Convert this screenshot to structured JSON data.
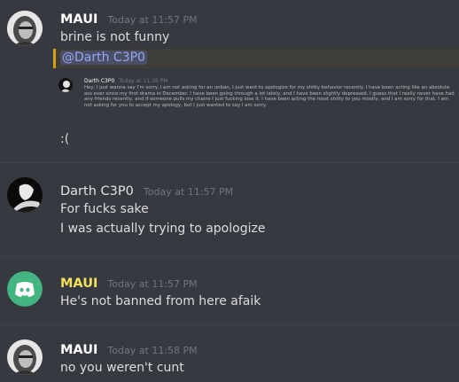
{
  "messages": [
    {
      "username": "MAUI",
      "timestamp": "Today at 11:57 PM",
      "lines": [
        "brine is not funny"
      ],
      "mention": "@Darth C3P0",
      "embed": {
        "username": "Darth C3P0",
        "timestamp": "Today at 11:38 PM",
        "text": "Hey, I just wanna say I'm sorry. I am not asking for an unban, I just want to apologize for my shitty behavior recently. I have been acting like an absolute ass ever since my first drama in December. I have been going through a lot lately, and I have been slightly depressed. I guess that I really never have had any friends recently, and if someone pulls my chains I just fucking lose it. I have been acting the most shitty to you mostly, and I am sorry for that. I am not asking for you to accept my apology, but I just wanted to say I am sorry."
      },
      "after": ":("
    },
    {
      "username": "Darth C3P0",
      "timestamp": "Today at 11:57 PM",
      "lines": [
        "For fucks sake",
        "I was actually trying to apologize"
      ]
    },
    {
      "username": "MAUI",
      "timestamp": "Today at 11:57 PM",
      "lines": [
        "He's not banned from here afaik"
      ]
    },
    {
      "username": "MAUI",
      "timestamp": "Today at 11:58 PM",
      "lines": [
        "no you weren't cunt"
      ]
    }
  ],
  "colors": {
    "background": "#36393f",
    "username_white": "#ffffff",
    "username_gold": "#f1e05a",
    "timestamp": "#72767d",
    "text": "#dcddde",
    "mention": "#95a6f3",
    "mention_bar": "#d4a017",
    "discord_blurple": "#43b581"
  },
  "icons": {
    "avatar1": "user-portrait-avatar",
    "avatar2": "dark-silhouette-avatar",
    "avatar3": "discord-logo-avatar"
  }
}
